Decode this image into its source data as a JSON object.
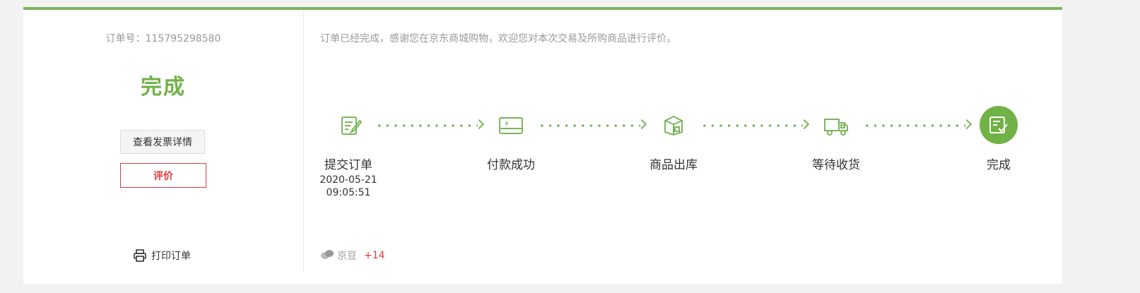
{
  "order": {
    "number_label": "订单号：",
    "number_value": "115795298580",
    "status": "完成"
  },
  "buttons": {
    "invoice_label": "查看发票详情",
    "review_label": "评价",
    "print_label": "打印订单"
  },
  "message": "订单已经完成，感谢您在京东商城购物，欢迎您对本次交易及所购商品进行评价。",
  "steps": [
    {
      "label": "提交订单",
      "date": "2020-05-21",
      "time": "09:05:51",
      "icon": "submit-order-icon"
    },
    {
      "label": "付款成功",
      "icon": "payment-card-icon"
    },
    {
      "label": "商品出库",
      "icon": "package-box-icon"
    },
    {
      "label": "等待收货",
      "icon": "delivery-truck-icon"
    },
    {
      "label": "完成",
      "icon": "completed-check-icon"
    }
  ],
  "beans": {
    "label": "京豆",
    "value": "+14",
    "icon": "jingdou-bean-icon"
  },
  "colors": {
    "accent_green": "#71b247",
    "line_green": "#7ab55c",
    "red": "#e4393c"
  }
}
